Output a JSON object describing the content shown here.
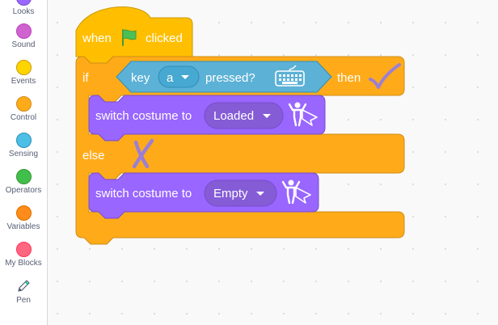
{
  "categories": [
    {
      "label": "Looks",
      "color": "#9966ff",
      "border": "#774dcb"
    },
    {
      "label": "Sound",
      "color": "#cf63cf",
      "border": "#bd42bd"
    },
    {
      "label": "Events",
      "color": "#ffd500",
      "border": "#cc9900"
    },
    {
      "label": "Control",
      "color": "#ffab19",
      "border": "#cf8b17"
    },
    {
      "label": "Sensing",
      "color": "#4cbfe6",
      "border": "#2e8eb8"
    },
    {
      "label": "Operators",
      "color": "#40bf4a",
      "border": "#389438"
    },
    {
      "label": "Variables",
      "color": "#ff8c1a",
      "border": "#db6e00"
    },
    {
      "label": "My Blocks",
      "color": "#ff6680",
      "border": "#ff3355"
    },
    {
      "label": "Pen",
      "icon": "pen-icon"
    }
  ],
  "script": {
    "hat": {
      "when": "when",
      "flag_icon": "green-flag-icon",
      "clicked": "clicked"
    },
    "if_block": {
      "if": "if",
      "then": "then",
      "else": "else",
      "check_icon": "checkmark-icon",
      "cross_icon": "cross-icon"
    },
    "condition": {
      "key": "key",
      "key_value": "a",
      "pressed": "pressed?",
      "icon": "keyboard-icon"
    },
    "then_action": {
      "text": "switch costume to",
      "value": "Loaded",
      "icon": "costume-hero-icon"
    },
    "else_action": {
      "text": "switch costume to",
      "value": "Empty",
      "icon": "costume-hero-icon"
    }
  },
  "colors": {
    "events": "#ffbf00",
    "control": "#ffab19",
    "sensing": "#5cb1d6",
    "looks": "#9966ff",
    "annotation": "#9b7fd4"
  }
}
